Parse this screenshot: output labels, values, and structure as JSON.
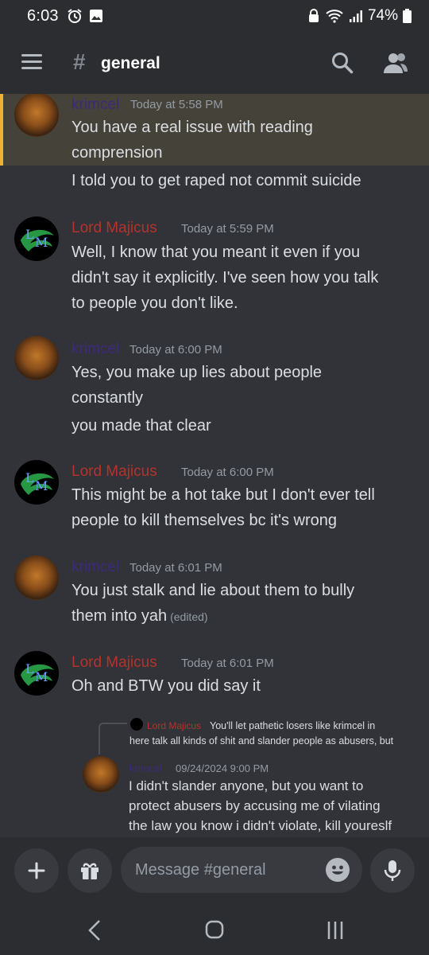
{
  "status_bar": {
    "time": "6:03",
    "battery": "74%"
  },
  "header": {
    "channel_hash": "#",
    "channel_name": "general"
  },
  "messages": [
    {
      "author": "krimcel",
      "timestamp": "Today at 5:58 PM",
      "lines": [
        "You have a real issue with reading",
        "comprension",
        "I told you to get raped not commit suicide"
      ]
    },
    {
      "author": "Lord Majicus",
      "timestamp": "Today at 5:59 PM",
      "lines": [
        "Well, I know that you meant it even if you",
        "didn't say it explicitly.  I've seen how you talk",
        "to people you don't like."
      ]
    },
    {
      "author": "krimcel",
      "timestamp": "Today at 6:00 PM",
      "lines": [
        "Yes, you make up lies about people",
        "constantly",
        "you made that clear"
      ]
    },
    {
      "author": "Lord Majicus",
      "timestamp": "Today at 6:00 PM",
      "lines": [
        "This might be a hot take but I don't ever tell",
        "people to kill themselves bc it's wrong"
      ]
    },
    {
      "author": "krimcel",
      "timestamp": "Today at 6:01 PM",
      "lines": [
        "You just stalk and lie about them to bully",
        "them into yah"
      ],
      "edited": "(edited)"
    },
    {
      "author": "Lord Majicus",
      "timestamp": "Today at 6:01 PM",
      "lines": [
        "Oh and BTW you did say it"
      ]
    }
  ],
  "reply": {
    "author": "Lord Majicus",
    "lines": [
      "You'll let pathetic losers like krimcel in",
      "here talk all kinds of shit and slander people as abusers, but"
    ]
  },
  "embed": {
    "author": "krimcel",
    "timestamp": "09/24/2024 9:00 PM",
    "lines": [
      "I didn't slander anyone, but you want to",
      "protect abusers by accusing me of vilating",
      "the law you know i didn't violate, kill youreslf"
    ]
  },
  "input": {
    "placeholder": "Message #general"
  },
  "colors": {
    "background": "#313338",
    "krimcel_name": "#3d2a7a",
    "lord_name": "#b5332b",
    "highlight": "#45423a",
    "highlight_bar": "#f0b232"
  },
  "icons": {
    "status_left": [
      "alarm-icon",
      "gallery-icon"
    ],
    "status_right": [
      "vpn-lock-icon",
      "wifi-icon",
      "signal-icon",
      "battery-icon"
    ],
    "header": [
      "hamburger-icon",
      "search-icon",
      "members-icon"
    ],
    "input": [
      "plus-icon",
      "gift-icon",
      "emoji-icon",
      "microphone-icon"
    ],
    "nav": [
      "back-icon",
      "home-icon",
      "recents-icon"
    ]
  }
}
